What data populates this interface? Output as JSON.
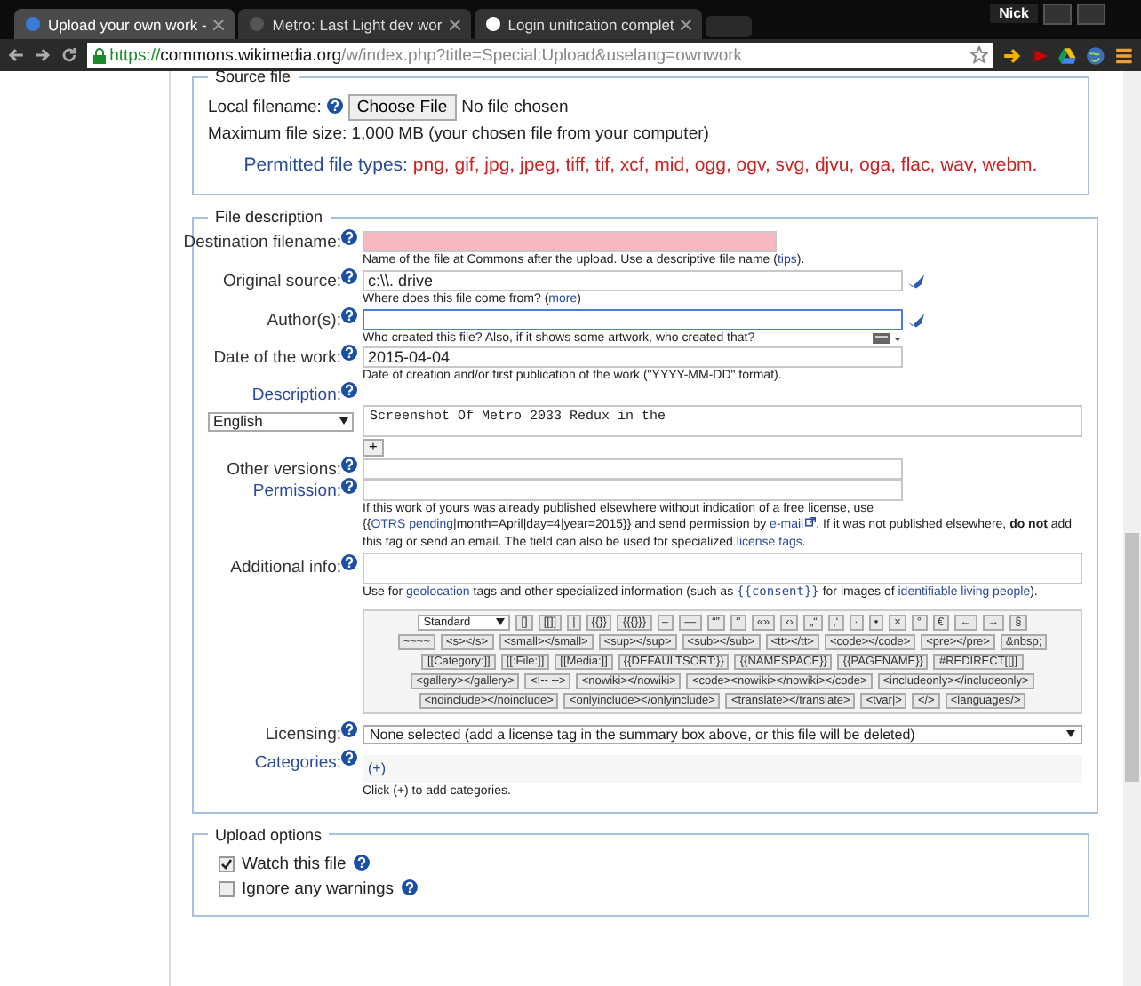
{
  "browser": {
    "tabs": [
      {
        "title": "Upload your own work -",
        "selected": true
      },
      {
        "title": "Metro: Last Light dev wor",
        "selected": false
      },
      {
        "title": "Login unification complet",
        "selected": false
      }
    ],
    "user": "Nick",
    "url_scheme": "https://",
    "url_host": "commons.wikimedia.org",
    "url_path": "/w/index.php?title=Special:Upload&uselang=ownwork"
  },
  "source_file": {
    "legend": "Source file",
    "label": "Local filename:",
    "choose_button": "Choose File",
    "no_file": "No file chosen",
    "max_size": "Maximum file size: 1,000 MB (your chosen file from your computer)",
    "permitted_label": "Permitted file types:",
    "permitted_types": "png, gif, jpg, jpeg, tiff, tif, xcf, mid, ogg, ogv, svg, djvu, oga, flac, wav, webm."
  },
  "file_description": {
    "legend": "File description",
    "rows": [
      {
        "kind": "input",
        "label": "Destination filename:",
        "label_link": false,
        "value": "",
        "invalid": true,
        "focused": false,
        "validated": false,
        "help": [
          {
            "kind": "text",
            "text": "Name of the file at Commons after the upload. Use a descriptive file name ("
          },
          {
            "kind": "link",
            "text": "tips"
          },
          {
            "kind": "text",
            "text": ")."
          }
        ]
      },
      {
        "kind": "input",
        "label": "Original source:",
        "label_link": false,
        "value": "c:\\\\. drive",
        "invalid": false,
        "focused": false,
        "validated": true,
        "help": [
          {
            "kind": "text",
            "text": "Where does this file come from? ("
          },
          {
            "kind": "link",
            "text": "more"
          },
          {
            "kind": "text",
            "text": ")"
          }
        ]
      },
      {
        "kind": "input",
        "label": "Author(s):",
        "label_link": false,
        "value": "",
        "invalid": false,
        "focused": true,
        "validated": true,
        "keyboard": true,
        "help": [
          {
            "kind": "text",
            "text": "Who created this file? Also, if it shows some artwork, who created that?"
          }
        ]
      },
      {
        "kind": "input",
        "label": "Date of the work:",
        "label_link": false,
        "value": "2015-04-04",
        "invalid": false,
        "focused": false,
        "validated": false,
        "help": [
          {
            "kind": "text",
            "text": "Date of creation and/or first publication of the work (\"YYYY-MM-DD\" format)."
          }
        ]
      },
      {
        "kind": "description",
        "label": "Description:",
        "label_link": true,
        "language": "English",
        "value": "Screenshot Of Metro 2033 Redux in the",
        "add_button": "+"
      },
      {
        "kind": "input",
        "label": "Other versions:",
        "label_link": false,
        "value": "",
        "invalid": false,
        "focused": false,
        "validated": false
      },
      {
        "kind": "input",
        "label": "Permission:",
        "label_link": true,
        "value": "",
        "invalid": false,
        "focused": false,
        "validated": false,
        "help": [
          {
            "kind": "text",
            "text": "If this work of yours was already published elsewhere without indication of a free license, use {{"
          },
          {
            "kind": "link",
            "text": "OTRS pending"
          },
          {
            "kind": "text",
            "text": "|month=April|day=4|year=2015}} and send permission by "
          },
          {
            "kind": "extlink",
            "text": "e-mail"
          },
          {
            "kind": "text",
            "text": ". If it was not published elsewhere, "
          },
          {
            "kind": "bold",
            "text": "do not"
          },
          {
            "kind": "text",
            "text": " add this tag or send an email. The field can also be used for specialized "
          },
          {
            "kind": "link",
            "text": "license tags"
          },
          {
            "kind": "text",
            "text": "."
          }
        ]
      },
      {
        "kind": "textarea",
        "label": "Additional info:",
        "label_link": false,
        "value": "",
        "help": [
          {
            "kind": "text",
            "text": "Use for "
          },
          {
            "kind": "link",
            "text": "geolocation"
          },
          {
            "kind": "text",
            "text": " tags and other specialized information (such as "
          },
          {
            "kind": "code",
            "text": "{{consent}}"
          },
          {
            "kind": "text",
            "text": " for images of "
          },
          {
            "kind": "link",
            "text": "identifiable living people"
          },
          {
            "kind": "text",
            "text": ")."
          }
        ]
      },
      {
        "kind": "charinsert",
        "select": "Standard",
        "button_rows": [
          [
            "[]",
            "[[]]",
            "|",
            "{{}}",
            "{{{}}}",
            "–",
            "—",
            "“”",
            "‘’",
            "«»",
            "‹›",
            "„“",
            "‚‘",
            "·",
            "•",
            "×",
            "°",
            "€",
            "←",
            "→",
            "§"
          ],
          [
            "~~~~",
            "<s></s>",
            "<small></small>",
            "<sup></sup>",
            "<sub></sub>",
            "<tt></tt>",
            "<code></code>",
            "<pre></pre>",
            "&nbsp;"
          ],
          [
            "[[Category:]]",
            "[[:File:]]",
            "[[Media:]]",
            "{{DEFAULTSORT:}}",
            "{{NAMESPACE}}",
            "{{PAGENAME}}",
            "#REDIRECT[[]]"
          ],
          [
            "<gallery></gallery>",
            "<!-- -->",
            "<nowiki></nowiki>",
            "<code><nowiki></nowiki></code>",
            "<includeonly></includeonly>"
          ],
          [
            "<noinclude></noinclude>",
            "<onlyinclude></onlyinclude>",
            "<translate></translate>",
            "<tvar|>",
            "</>",
            "<languages/>"
          ]
        ]
      },
      {
        "kind": "select",
        "label": "Licensing:",
        "label_link": false,
        "value": "None selected (add a license tag in the summary box above, or this file will be deleted)"
      },
      {
        "kind": "categories",
        "label": "Categories:",
        "label_link": true,
        "add_link": "(+)",
        "help": [
          {
            "kind": "text",
            "text": "Click (+) to add categories."
          }
        ]
      }
    ]
  },
  "upload_options": {
    "legend": "Upload options",
    "options": [
      {
        "label": "Watch this file",
        "checked": true
      },
      {
        "label": "Ignore any warnings",
        "checked": false
      }
    ]
  }
}
